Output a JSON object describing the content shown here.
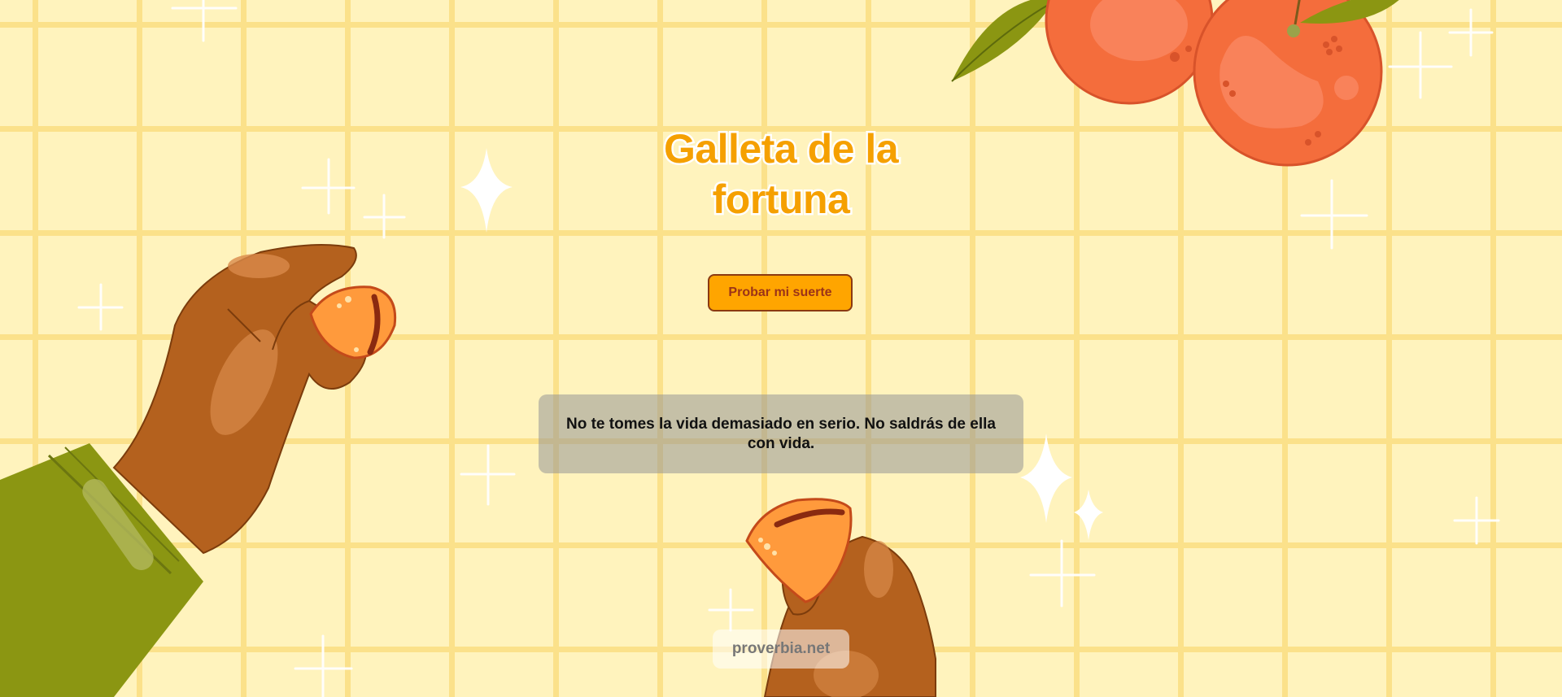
{
  "header": {
    "title": "Galleta de la fortuna"
  },
  "actions": {
    "try_luck_label": "Probar mi suerte"
  },
  "fortune": {
    "message": "No te tomes la vida demasiado en serio. No saldrás de ella con vida."
  },
  "footer": {
    "source_label": "proverbia.net"
  },
  "decor": {
    "icons": [
      "hand-icon",
      "fortune-cookie-icon",
      "orange-icon",
      "leaf-icon",
      "sparkle-icon"
    ],
    "colors": {
      "background": "#fff3bd",
      "grid": "#fbe18a",
      "title": "#f5a000",
      "button": "#ffa500",
      "button_text": "#9b3318",
      "skin": "#b4611e",
      "cookie": "#ff9a3c",
      "sleeve": "#8b9612",
      "orange": "#f46d3c"
    }
  }
}
